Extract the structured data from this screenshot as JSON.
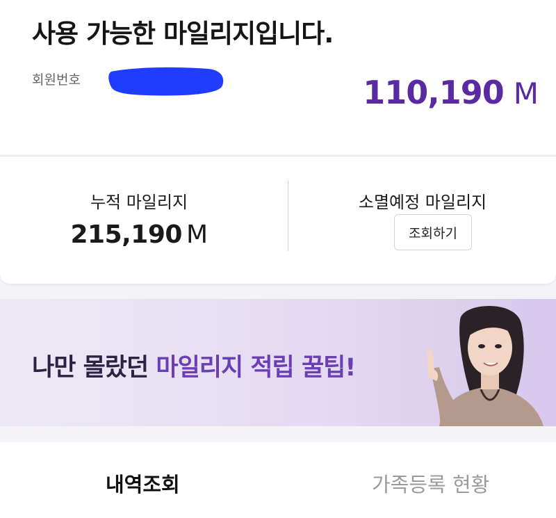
{
  "header": {
    "title": "사용 가능한 마일리지입니다.",
    "member_label": "회원번호",
    "balance_value": "110,190",
    "balance_unit": "M"
  },
  "summary": {
    "accumulated_label": "누적 마일리지",
    "accumulated_value": "215,190",
    "accumulated_unit": "M",
    "expiring_label": "소멸예정 마일리지",
    "lookup_button": "조회하기"
  },
  "banner": {
    "text_prefix": "나만 몰랐던 ",
    "text_highlight": "마일리지 적립 꿀팁!"
  },
  "tabs": [
    {
      "label": "내역조회",
      "active": true
    },
    {
      "label": "가족등록 현황",
      "active": false
    }
  ],
  "colors": {
    "accent": "#5a2aa3",
    "redaction": "#1f3cff"
  }
}
